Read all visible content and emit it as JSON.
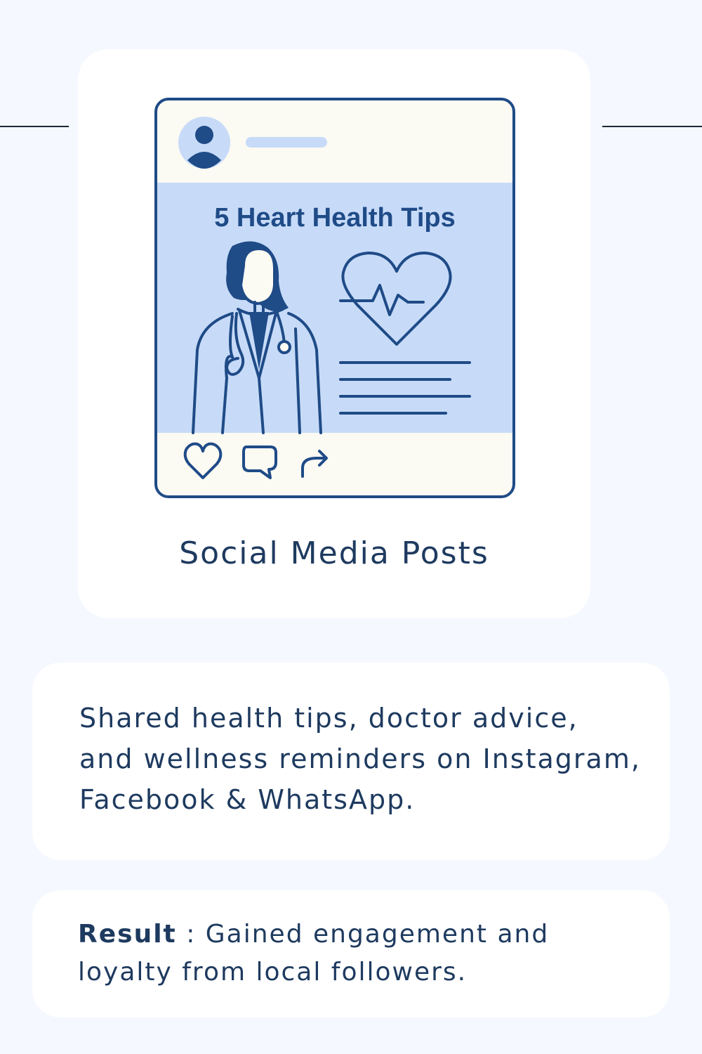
{
  "card": {
    "illustration": {
      "post_headline": "5 Heart Health Tips",
      "icons": [
        "avatar-icon",
        "doctor-icon",
        "heart-pulse-icon",
        "like-icon",
        "comment-icon",
        "share-icon"
      ]
    },
    "title": "Social Media Posts"
  },
  "description": {
    "text": "Shared health tips, doctor advice, and wellness reminders on Instagram, Facebook & WhatsApp."
  },
  "result": {
    "label": "Result",
    "separator": " : ",
    "text": "Gained engagement and loyalty from local followers."
  },
  "colors": {
    "page_background": "#f5f8fe",
    "card_background": "#ffffff",
    "text": "#1e3a5f",
    "illustration_stroke": "#1f4b87",
    "illustration_fill": "#c7dbf8",
    "post_background": "#fbfaf3"
  }
}
